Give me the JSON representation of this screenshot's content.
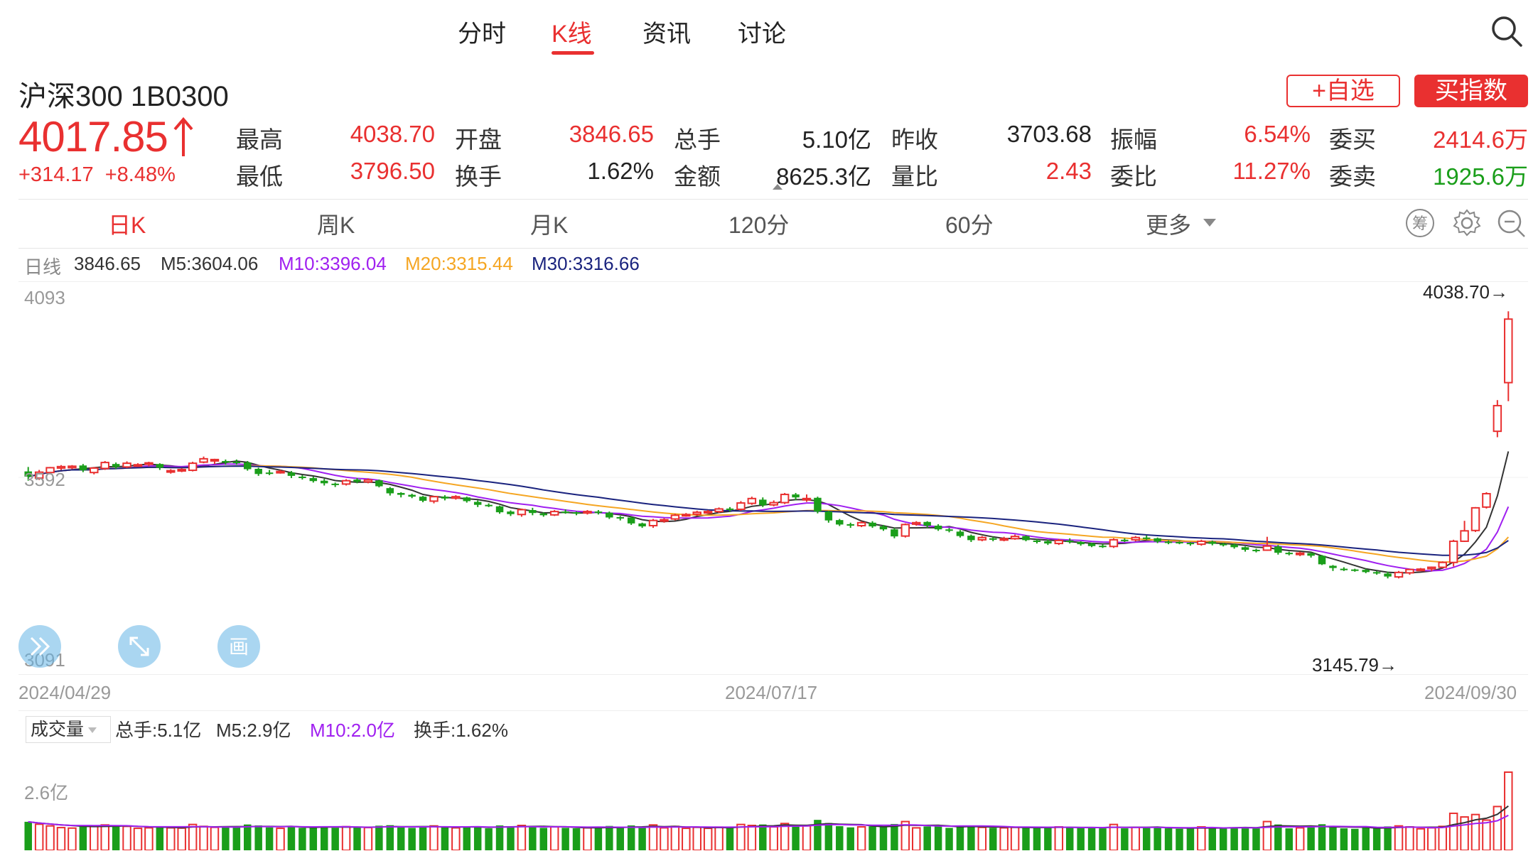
{
  "nav": {
    "tabs": [
      {
        "label": "分时"
      },
      {
        "label": "K线"
      },
      {
        "label": "资讯"
      },
      {
        "label": "讨论"
      }
    ],
    "active_tab": "K线"
  },
  "header": {
    "title": "沪深300 1B0300",
    "watch_button": "+自选",
    "buy_button": "买指数"
  },
  "quote": {
    "price": "4017.85",
    "change": "+314.17",
    "change_pct": "+8.48%",
    "fields": {
      "high_label": "最高",
      "high": "4038.70",
      "open_label": "开盘",
      "open": "3846.65",
      "volume_label": "总手",
      "volume": "5.10亿",
      "prev_close_label": "昨收",
      "prev_close": "3703.68",
      "amplitude_label": "振幅",
      "amplitude": "6.54%",
      "bid_label": "委买",
      "bid": "2414.6万",
      "low_label": "最低",
      "low": "3796.50",
      "turnover_label": "换手",
      "turnover": "1.62%",
      "amount_label": "金额",
      "amount": "8625.3亿",
      "vol_ratio_label": "量比",
      "vol_ratio": "2.43",
      "order_ratio_label": "委比",
      "order_ratio": "11.27%",
      "ask_label": "委卖",
      "ask": "1925.6万"
    }
  },
  "periods": {
    "tabs": [
      "日K",
      "周K",
      "月K",
      "120分",
      "60分",
      "更多"
    ],
    "active": "日K"
  },
  "ma_legend": {
    "daily": "日线",
    "close": "3846.65",
    "m5": "M5:3604.06",
    "m10": "M10:3396.04",
    "m20": "M20:3315.44",
    "m30": "M30:3316.66"
  },
  "colors": {
    "up": "#e93030",
    "down": "#1a9e1a",
    "m5": "#333333",
    "m10": "#a020f0",
    "m20": "#f5a623",
    "m30": "#1a237e"
  },
  "kline": {
    "y_top": "4093",
    "y_mid": "3592",
    "y_bottom": "3091",
    "dates": [
      "2024/04/29",
      "2024/07/17",
      "2024/09/30"
    ],
    "max_label": "4038.70→",
    "min_label": "3145.79→"
  },
  "volume": {
    "selector": "成交量",
    "total": "总手:5.1亿",
    "m5": "M5:2.9亿",
    "m10": "M10:2.0亿",
    "turnover": "换手:1.62%",
    "y_label": "2.6亿"
  },
  "chart_data": {
    "type": "candlestick",
    "title": "沪深300 1B0300",
    "ylim": [
      3091,
      4093
    ],
    "candles": [
      [
        3608,
        3594,
        3620,
        3583
      ],
      [
        3590,
        3606,
        3612,
        3585
      ],
      [
        3605,
        3618,
        3620,
        3600
      ],
      [
        3617,
        3621,
        3625,
        3612
      ],
      [
        3618,
        3622,
        3625,
        3614
      ],
      [
        3624,
        3611,
        3628,
        3606
      ],
      [
        3605,
        3617,
        3620,
        3600
      ],
      [
        3616,
        3632,
        3636,
        3612
      ],
      [
        3628,
        3620,
        3632,
        3615
      ],
      [
        3620,
        3630,
        3635,
        3617
      ],
      [
        3626,
        3626,
        3630,
        3620
      ],
      [
        3628,
        3631,
        3634,
        3622
      ],
      [
        3628,
        3618,
        3630,
        3612
      ],
      [
        3610,
        3610,
        3614,
        3602
      ],
      [
        3610,
        3613,
        3617,
        3606
      ],
      [
        3611,
        3630,
        3634,
        3608
      ],
      [
        3633,
        3642,
        3648,
        3630
      ],
      [
        3638,
        3640,
        3642,
        3628
      ],
      [
        3636,
        3635,
        3640,
        3626
      ],
      [
        3634,
        3632,
        3640,
        3626
      ],
      [
        3632,
        3614,
        3636,
        3610
      ],
      [
        3615,
        3601,
        3618,
        3596
      ],
      [
        3605,
        3603,
        3612,
        3598
      ],
      [
        3607,
        3608,
        3612,
        3602
      ],
      [
        3605,
        3596,
        3609,
        3590
      ],
      [
        3594,
        3590,
        3598,
        3586
      ],
      [
        3590,
        3582,
        3594,
        3578
      ],
      [
        3583,
        3576,
        3588,
        3570
      ],
      [
        3575,
        3573,
        3578,
        3566
      ],
      [
        3574,
        3583,
        3587,
        3570
      ],
      [
        3586,
        3580,
        3590,
        3576
      ],
      [
        3580,
        3585,
        3589,
        3576
      ],
      [
        3584,
        3568,
        3586,
        3565
      ],
      [
        3563,
        3549,
        3566,
        3543
      ],
      [
        3550,
        3545,
        3552,
        3538
      ],
      [
        3545,
        3540,
        3548,
        3536
      ],
      [
        3540,
        3529,
        3542,
        3525
      ],
      [
        3528,
        3540,
        3542,
        3522
      ],
      [
        3540,
        3535,
        3544,
        3530
      ],
      [
        3536,
        3540,
        3544,
        3532
      ],
      [
        3538,
        3528,
        3540,
        3524
      ],
      [
        3526,
        3518,
        3530,
        3512
      ],
      [
        3518,
        3515,
        3522,
        3512
      ],
      [
        3514,
        3498,
        3516,
        3494
      ],
      [
        3500,
        3493,
        3503,
        3488
      ],
      [
        3492,
        3505,
        3508,
        3486
      ],
      [
        3504,
        3496,
        3510,
        3490
      ],
      [
        3495,
        3490,
        3498,
        3486
      ],
      [
        3491,
        3500,
        3504,
        3488
      ],
      [
        3500,
        3498,
        3506,
        3494
      ],
      [
        3498,
        3495,
        3500,
        3490
      ],
      [
        3496,
        3500,
        3504,
        3492
      ],
      [
        3500,
        3496,
        3504,
        3492
      ],
      [
        3497,
        3484,
        3500,
        3480
      ],
      [
        3485,
        3482,
        3488,
        3476
      ],
      [
        3484,
        3468,
        3486,
        3464
      ],
      [
        3468,
        3460,
        3470,
        3456
      ],
      [
        3462,
        3476,
        3480,
        3456
      ],
      [
        3475,
        3478,
        3482,
        3470
      ],
      [
        3480,
        3490,
        3494,
        3476
      ],
      [
        3491,
        3492,
        3496,
        3486
      ],
      [
        3493,
        3498,
        3502,
        3488
      ],
      [
        3498,
        3500,
        3504,
        3494
      ],
      [
        3500,
        3507,
        3511,
        3496
      ],
      [
        3508,
        3505,
        3512,
        3500
      ],
      [
        3506,
        3523,
        3528,
        3502
      ],
      [
        3522,
        3535,
        3540,
        3518
      ],
      [
        3532,
        3517,
        3538,
        3512
      ],
      [
        3518,
        3524,
        3530,
        3514
      ],
      [
        3524,
        3546,
        3550,
        3520
      ],
      [
        3546,
        3538,
        3550,
        3530
      ],
      [
        3535,
        3535,
        3546,
        3526
      ],
      [
        3537,
        3500,
        3540,
        3495
      ],
      [
        3500,
        3476,
        3502,
        3470
      ],
      [
        3477,
        3465,
        3480,
        3461
      ],
      [
        3466,
        3462,
        3470,
        3456
      ],
      [
        3462,
        3470,
        3474,
        3458
      ],
      [
        3470,
        3460,
        3474,
        3456
      ],
      [
        3460,
        3452,
        3464,
        3448
      ],
      [
        3452,
        3433,
        3456,
        3428
      ],
      [
        3434,
        3465,
        3468,
        3430
      ],
      [
        3466,
        3470,
        3474,
        3462
      ],
      [
        3472,
        3462,
        3474,
        3456
      ],
      [
        3462,
        3452,
        3466,
        3448
      ],
      [
        3452,
        3448,
        3456,
        3444
      ],
      [
        3446,
        3434,
        3450,
        3430
      ],
      [
        3435,
        3423,
        3438,
        3418
      ],
      [
        3424,
        3430,
        3434,
        3420
      ],
      [
        3428,
        3424,
        3432,
        3420
      ],
      [
        3425,
        3427,
        3432,
        3420
      ],
      [
        3427,
        3433,
        3438,
        3424
      ],
      [
        3434,
        3423,
        3436,
        3420
      ],
      [
        3422,
        3418,
        3426,
        3414
      ],
      [
        3420,
        3414,
        3424,
        3410
      ],
      [
        3414,
        3422,
        3426,
        3410
      ],
      [
        3422,
        3418,
        3428,
        3414
      ],
      [
        3418,
        3412,
        3420,
        3408
      ],
      [
        3414,
        3407,
        3416,
        3404
      ],
      [
        3408,
        3406,
        3412,
        3402
      ],
      [
        3406,
        3424,
        3428,
        3402
      ],
      [
        3424,
        3423,
        3428,
        3418
      ],
      [
        3424,
        3430,
        3434,
        3420
      ],
      [
        3430,
        3428,
        3436,
        3424
      ],
      [
        3428,
        3419,
        3430,
        3415
      ],
      [
        3419,
        3417,
        3422,
        3412
      ],
      [
        3418,
        3415,
        3420,
        3412
      ],
      [
        3416,
        3412,
        3418,
        3408
      ],
      [
        3412,
        3420,
        3424,
        3408
      ],
      [
        3419,
        3413,
        3422,
        3409
      ],
      [
        3413,
        3411,
        3416,
        3406
      ],
      [
        3411,
        3404,
        3414,
        3400
      ],
      [
        3404,
        3397,
        3406,
        3392
      ],
      [
        3397,
        3395,
        3400,
        3390
      ],
      [
        3396,
        3407,
        3432,
        3394
      ],
      [
        3406,
        3389,
        3410,
        3384
      ],
      [
        3389,
        3387,
        3392,
        3382
      ],
      [
        3385,
        3388,
        3392,
        3380
      ],
      [
        3388,
        3381,
        3390,
        3376
      ],
      [
        3381,
        3358,
        3383,
        3356
      ],
      [
        3354,
        3348,
        3356,
        3340
      ],
      [
        3346,
        3344,
        3350,
        3340
      ],
      [
        3344,
        3342,
        3346,
        3338
      ],
      [
        3343,
        3337,
        3346,
        3334
      ],
      [
        3337,
        3335,
        3340,
        3330
      ],
      [
        3333,
        3325,
        3338,
        3320
      ],
      [
        3324,
        3336,
        3340,
        3320
      ],
      [
        3335,
        3344,
        3346,
        3330
      ],
      [
        3345,
        3345,
        3348,
        3340
      ],
      [
        3346,
        3350,
        3352,
        3340
      ],
      [
        3350,
        3363,
        3366,
        3348
      ],
      [
        3363,
        3420,
        3424,
        3352
      ],
      [
        3420,
        3448,
        3475,
        3418
      ],
      [
        3449,
        3510,
        3512,
        3445
      ],
      [
        3512,
        3548,
        3552,
        3508
      ],
      [
        3716,
        3785,
        3800,
        3700
      ],
      [
        3847,
        4018,
        4039,
        3797
      ]
    ],
    "ma": {
      "M5": "3604.06",
      "M10": "3396.04",
      "M20": "3315.44",
      "M30": "3316.66"
    },
    "volume_series_label": "成交量",
    "volume_last": "5.1亿"
  }
}
